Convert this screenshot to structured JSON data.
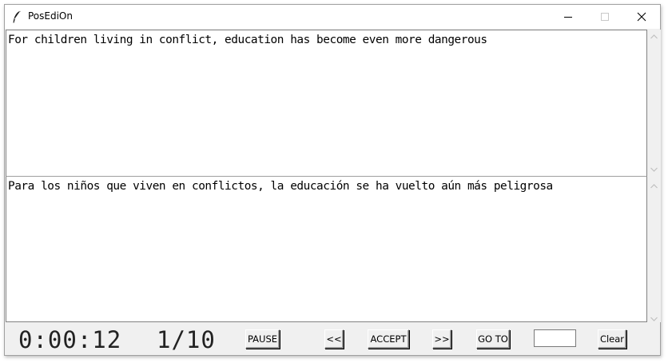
{
  "window": {
    "title": "PosEdiOn"
  },
  "source_pane": {
    "text": "For children living in conflict, education has become even more dangerous"
  },
  "target_pane": {
    "text": "Para los niños que viven en conflictos, la educación se ha vuelto aún más peligrosa"
  },
  "status": {
    "timer": "0:00:12",
    "counter": "1/10"
  },
  "toolbar": {
    "pause_label": "PAUSE",
    "prev_label": "<<",
    "accept_label": "ACCEPT",
    "next_label": ">>",
    "goto_label": "GO TO",
    "goto_value": "",
    "clear_label": "Clear"
  },
  "icons": {
    "app": "feather-icon",
    "minimize": "minimize-icon",
    "maximize": "maximize-icon",
    "close": "close-icon"
  }
}
